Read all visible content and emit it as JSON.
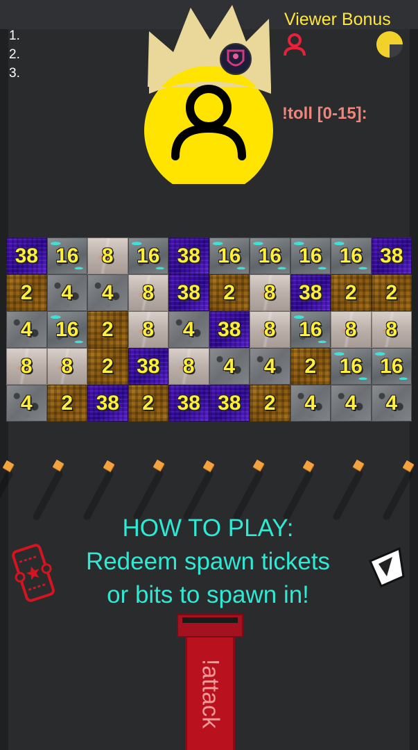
{
  "leaderboard": {
    "ranks": [
      "1.",
      "2.",
      "3."
    ]
  },
  "viewer_bonus": {
    "title": "Viewer Bonus",
    "timer_fraction": 0.75,
    "accent": "#ffe83a",
    "person_color": "#e8213a"
  },
  "toll": {
    "label": "!toll [0-15]:",
    "color": "#f0857b"
  },
  "king": {
    "face_color": "#ffe400",
    "crown_color": "#e9d89a",
    "icon": "person-icon"
  },
  "board": {
    "rows": [
      [
        "38",
        "16",
        "8",
        "16",
        "38",
        "16",
        "16",
        "16",
        "16",
        "38"
      ],
      [
        "2",
        "4",
        "4",
        "8",
        "38",
        "2",
        "8",
        "38",
        "2",
        "2"
      ],
      [
        "4",
        "16",
        "2",
        "8",
        "4",
        "38",
        "8",
        "16",
        "8",
        "8"
      ],
      [
        "8",
        "8",
        "2",
        "38",
        "8",
        "4",
        "4",
        "2",
        "16",
        "16"
      ],
      [
        "4",
        "2",
        "38",
        "2",
        "38",
        "38",
        "2",
        "4",
        "4",
        "4"
      ]
    ]
  },
  "instructions": {
    "lines": [
      "HOW TO PLAY:",
      "Redeem spawn tickets",
      "or bits to spawn in!"
    ],
    "color": "#2ee9d3"
  },
  "icons": {
    "ticket": "ticket-icon",
    "bits": "bits-gem-icon"
  },
  "cannon": {
    "label": "!attack",
    "color": "#b9111e"
  }
}
